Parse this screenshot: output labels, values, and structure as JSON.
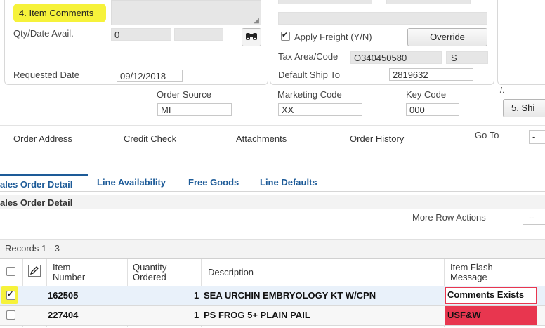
{
  "header_form": {
    "item_comments_label": "4. Item Comments",
    "qty_date_label": "Qty/Date Avail.",
    "qty_value": "0",
    "qty_value2": "",
    "requested_date_label": "Requested Date",
    "requested_date_value": "09/12/2018",
    "apply_freight_label": "Apply Freight (Y/N)",
    "override_label": "Override",
    "tax_area_label": "Tax Area/Code",
    "tax_area_value": "O340450580",
    "tax_code_value": "S",
    "default_ship_label": "Default Ship To",
    "default_ship_value": "2819632",
    "order_source_label": "Order Source",
    "order_source_value": "MI",
    "marketing_code_label": "Marketing Code",
    "marketing_code_value": "XX",
    "key_code_label": "Key Code",
    "key_code_value": "000",
    "ship_button_label": "5. Shi",
    "fragment_text": "./."
  },
  "links": {
    "order_address": "Order Address",
    "credit_check": "Credit Check",
    "attachments": "Attachments",
    "order_history": "Order History",
    "go_to_label": "Go To",
    "go_to_value": "-"
  },
  "tabs": {
    "sales_order_detail": "ales Order Detail",
    "line_availability": "Line Availability",
    "free_goods": "Free Goods",
    "line_defaults": "Line Defaults"
  },
  "section_title": "ales Order Detail",
  "more_row_actions_label": "More Row Actions",
  "more_row_actions_value": "--",
  "records_label": "Records 1 - 3",
  "table": {
    "headers": {
      "item_number": [
        "Item",
        "Number"
      ],
      "quantity": [
        "Quantity",
        "Ordered"
      ],
      "description": "Description",
      "flash_message": [
        "Item Flash",
        "Message"
      ]
    },
    "rows": [
      {
        "item": "162505",
        "qty": "1",
        "desc": "SEA URCHIN EMBRYOLOGY KT W/CPN",
        "flash": "Comments Exists",
        "checked": true
      },
      {
        "item": "227404",
        "qty": "1",
        "desc": "PS FROG 5+ PLAIN PAIL",
        "flash": "USF&W",
        "checked": false
      }
    ]
  },
  "colors": {
    "highlight": "#f6f23a",
    "tab_blue": "#1d5b98",
    "flash_red": "#e8364f",
    "flash_border": "#e8364f"
  }
}
